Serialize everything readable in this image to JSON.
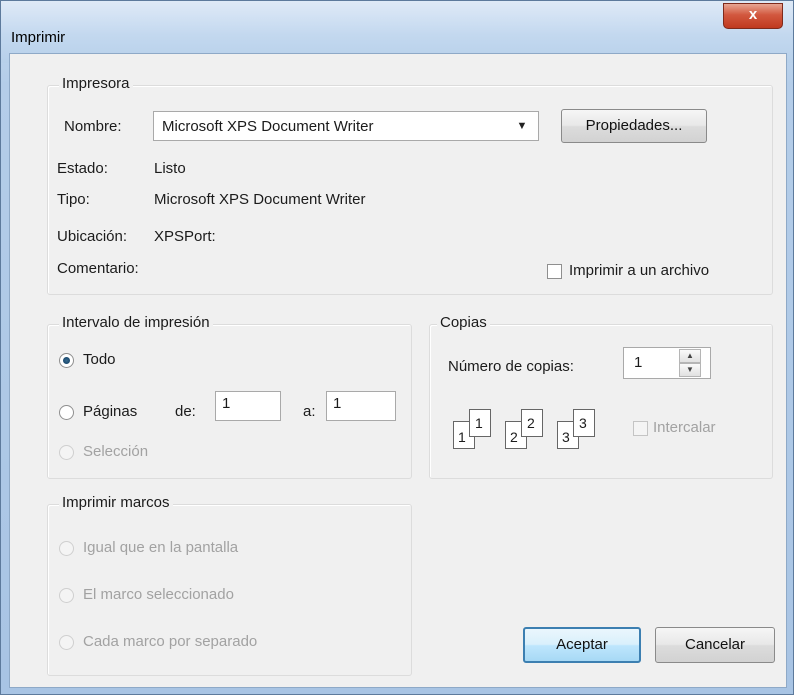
{
  "window": {
    "title": "Imprimir",
    "close_glyph": "x"
  },
  "printer": {
    "group_label": "Impresora",
    "name_label": "Nombre:",
    "name_value": "Microsoft XPS Document Writer",
    "properties_button": "Propiedades...",
    "status_label": "Estado:",
    "status_value": "Listo",
    "type_label": "Tipo:",
    "type_value": "Microsoft XPS Document Writer",
    "location_label": "Ubicación:",
    "location_value": "XPSPort:",
    "comment_label": "Comentario:",
    "print_to_file_label": "Imprimir a un archivo",
    "print_to_file_checked": false
  },
  "range": {
    "group_label": "Intervalo de impresión",
    "all_label": "Todo",
    "pages_label": "Páginas",
    "from_label": "de:",
    "from_value": "1",
    "to_label": "a:",
    "to_value": "1",
    "selection_label": "Selección",
    "selected_option": "Todo"
  },
  "copies": {
    "group_label": "Copias",
    "count_label": "Número de copias:",
    "count_value": "1",
    "collate_label": "Intercalar",
    "collate_checked": false,
    "collate_icon_numbers": [
      "1",
      "1",
      "2",
      "2",
      "3",
      "3"
    ]
  },
  "frames": {
    "group_label": "Imprimir marcos",
    "option_same": "Igual que en la pantalla",
    "option_selected": "El marco seleccionado",
    "option_each": "Cada marco por separado"
  },
  "buttons": {
    "ok": "Aceptar",
    "cancel": "Cancelar"
  },
  "colors": {
    "accent": "#3c7fb1",
    "close": "#c0391f",
    "frame": "#a8c4e4"
  }
}
